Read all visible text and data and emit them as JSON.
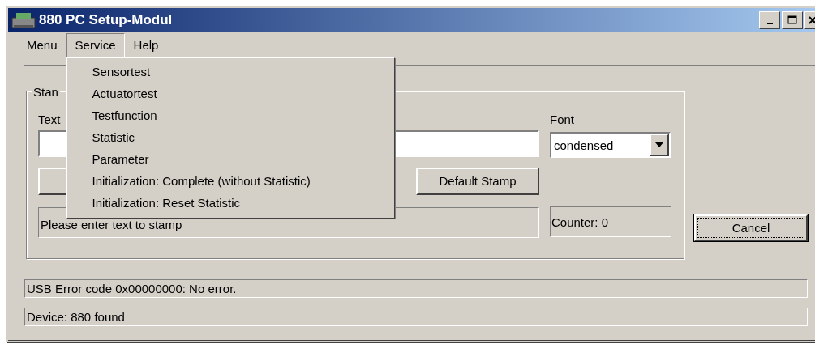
{
  "window": {
    "title": "880 PC Setup-Modul"
  },
  "menu_bar": [
    {
      "label": "Menu",
      "selected": false
    },
    {
      "label": "Service",
      "selected": true
    },
    {
      "label": "Help",
      "selected": false
    }
  ],
  "service_menu": [
    "Sensortest",
    "Actuatortest",
    "Testfunction",
    "Statistic",
    "Parameter",
    "Initialization: Complete (without Statistic)",
    "Initialization: Reset Statistic"
  ],
  "group": {
    "title": "Stan",
    "text_label": "Text",
    "default_button": "Default Stamp",
    "font_label": "Font",
    "font_select": "condensed",
    "message": "Please enter text to stamp",
    "counter": "Counter: 0"
  },
  "cancel_button": {
    "label": "Cancel",
    "focused": true
  },
  "status_lines": [
    "USB Error code 0x00000000: No error.",
    "Device: 880 found"
  ]
}
